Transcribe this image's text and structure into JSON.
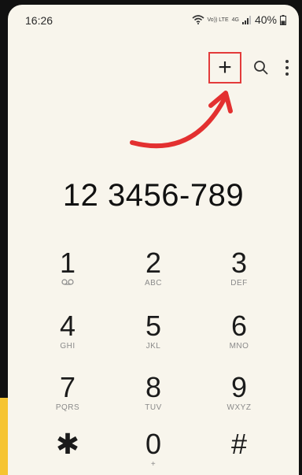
{
  "status": {
    "time": "16:26",
    "volte": "Vo)) LTE",
    "network": "4G",
    "battery": "40%"
  },
  "toolbar": {
    "add_label": "+",
    "search_icon": "search-icon",
    "more_icon": "more-vert-icon"
  },
  "dialer": {
    "number": "12 3456-789"
  },
  "keys": [
    {
      "digit": "1",
      "sub": ""
    },
    {
      "digit": "2",
      "sub": "ABC"
    },
    {
      "digit": "3",
      "sub": "DEF"
    },
    {
      "digit": "4",
      "sub": "GHI"
    },
    {
      "digit": "5",
      "sub": "JKL"
    },
    {
      "digit": "6",
      "sub": "MNO"
    },
    {
      "digit": "7",
      "sub": "PQRS"
    },
    {
      "digit": "8",
      "sub": "TUV"
    },
    {
      "digit": "9",
      "sub": "WXYZ"
    },
    {
      "digit": "✱",
      "sub": ""
    },
    {
      "digit": "0",
      "sub": "+"
    },
    {
      "digit": "#",
      "sub": ""
    }
  ],
  "colors": {
    "highlight": "#e33b3b",
    "background": "#f8f5ec",
    "accent_strip": "#f6c431"
  }
}
